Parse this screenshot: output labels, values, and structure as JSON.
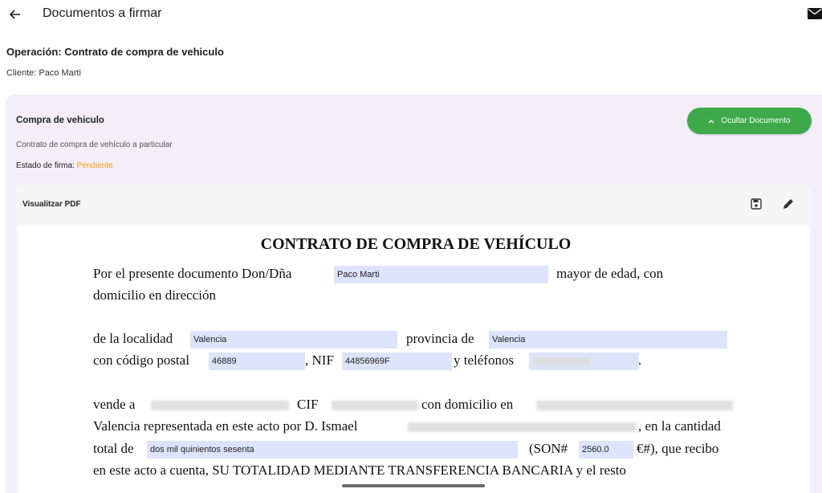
{
  "appbar": {
    "title": "Documentos a firmar",
    "back_icon": "arrow-back-icon",
    "mail_icon": "mail-icon"
  },
  "operation": {
    "label": "Operación: Contrato de compra de vehiculo",
    "client": "Cliente: Paco Marti"
  },
  "card": {
    "title": "Compra de vehiculo",
    "subtitle": "Contrato de compra de vehículo a particular",
    "status_label": "Estado de firma:",
    "status_value": "Pendiente",
    "status_color": "#f39c12",
    "hide_button": "Ocultar Documento",
    "hide_button_color": "#3ea94b"
  },
  "viewer": {
    "title": "Visualitzar PDF",
    "save_icon": "save-icon",
    "edit_icon": "pencil-icon"
  },
  "pdf": {
    "heading": "CONTRATO DE COMPRA DE VEHÍCULO",
    "p1_a": "Por el presente documento Don/Dña",
    "p1_b": "mayor de edad, con",
    "p1_c": "domicilio en dirección",
    "p2_a": "de la localidad",
    "p2_b": "provincia de",
    "p2_c": "con código postal",
    "p2_d": ", NIF",
    "p2_e": "y teléfonos",
    "p2_f": ".",
    "p3_a": "vende a",
    "p3_b": "CIF",
    "p3_c": "con domicilio en",
    "p3_d": "Valencia representada en este acto por D. Ismael",
    "p3_e": ", en la cantidad",
    "p3_f": "total de",
    "p3_g": "(SON#",
    "p3_h": "€#), que recibo",
    "p3_i": "en este acto a cuenta, SU TOTALIDAD MEDIANTE TRANSFERENCIA BANCARIA y el resto",
    "fields": {
      "name": "Paco Marti",
      "city": "Valencia",
      "province": "Valencia",
      "postal_code": "46889",
      "nif": "44856969F",
      "amount_words": "dos mil quinientos sesenta",
      "amount_number": "2560.0"
    }
  }
}
